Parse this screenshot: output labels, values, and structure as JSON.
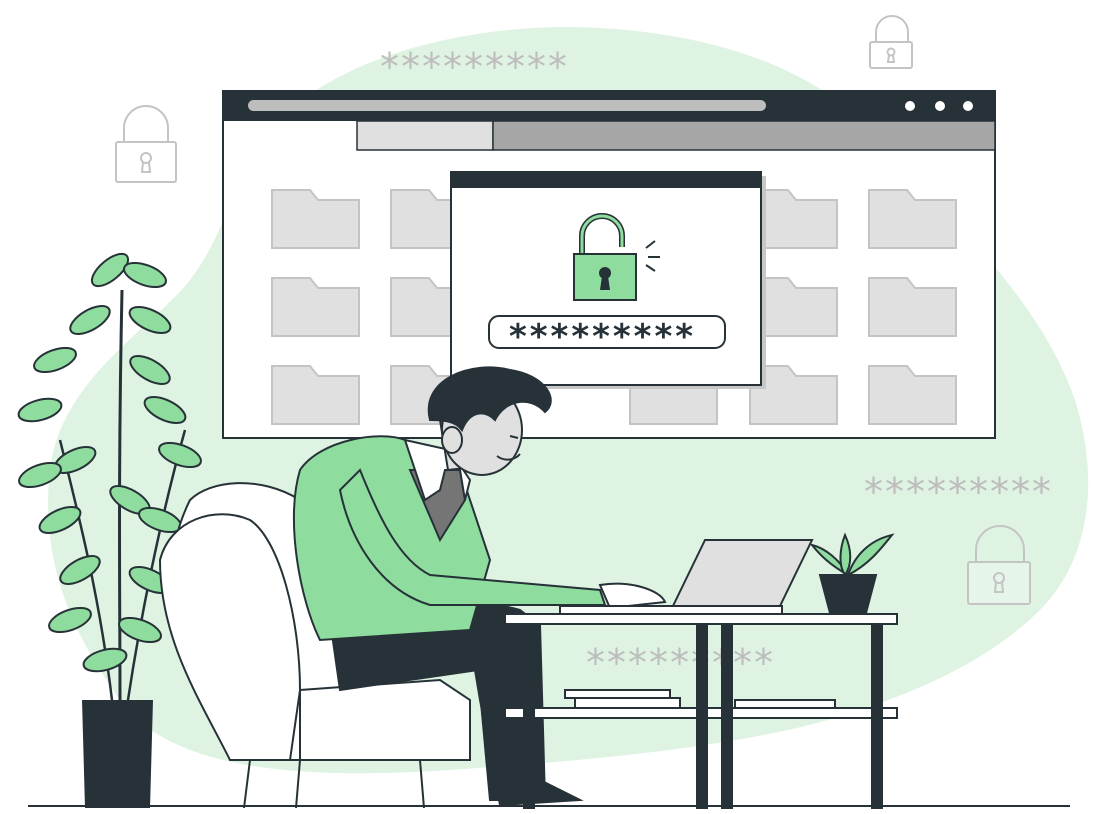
{
  "dialog": {
    "password_mask": "*********"
  },
  "decor": {
    "stars_top": "*********",
    "stars_right": "*********",
    "stars_bottom": "*********"
  },
  "colors": {
    "accent_green": "#8fdc9f",
    "blob_green": "#dff3e3",
    "dark": "#263238",
    "folder_gray": "#e0e0e0",
    "outline_gray": "#c4c4c4"
  },
  "icons": {
    "padlock": "lock-open-icon",
    "folder": "folder-icon",
    "window_controls": "dots-icon"
  }
}
